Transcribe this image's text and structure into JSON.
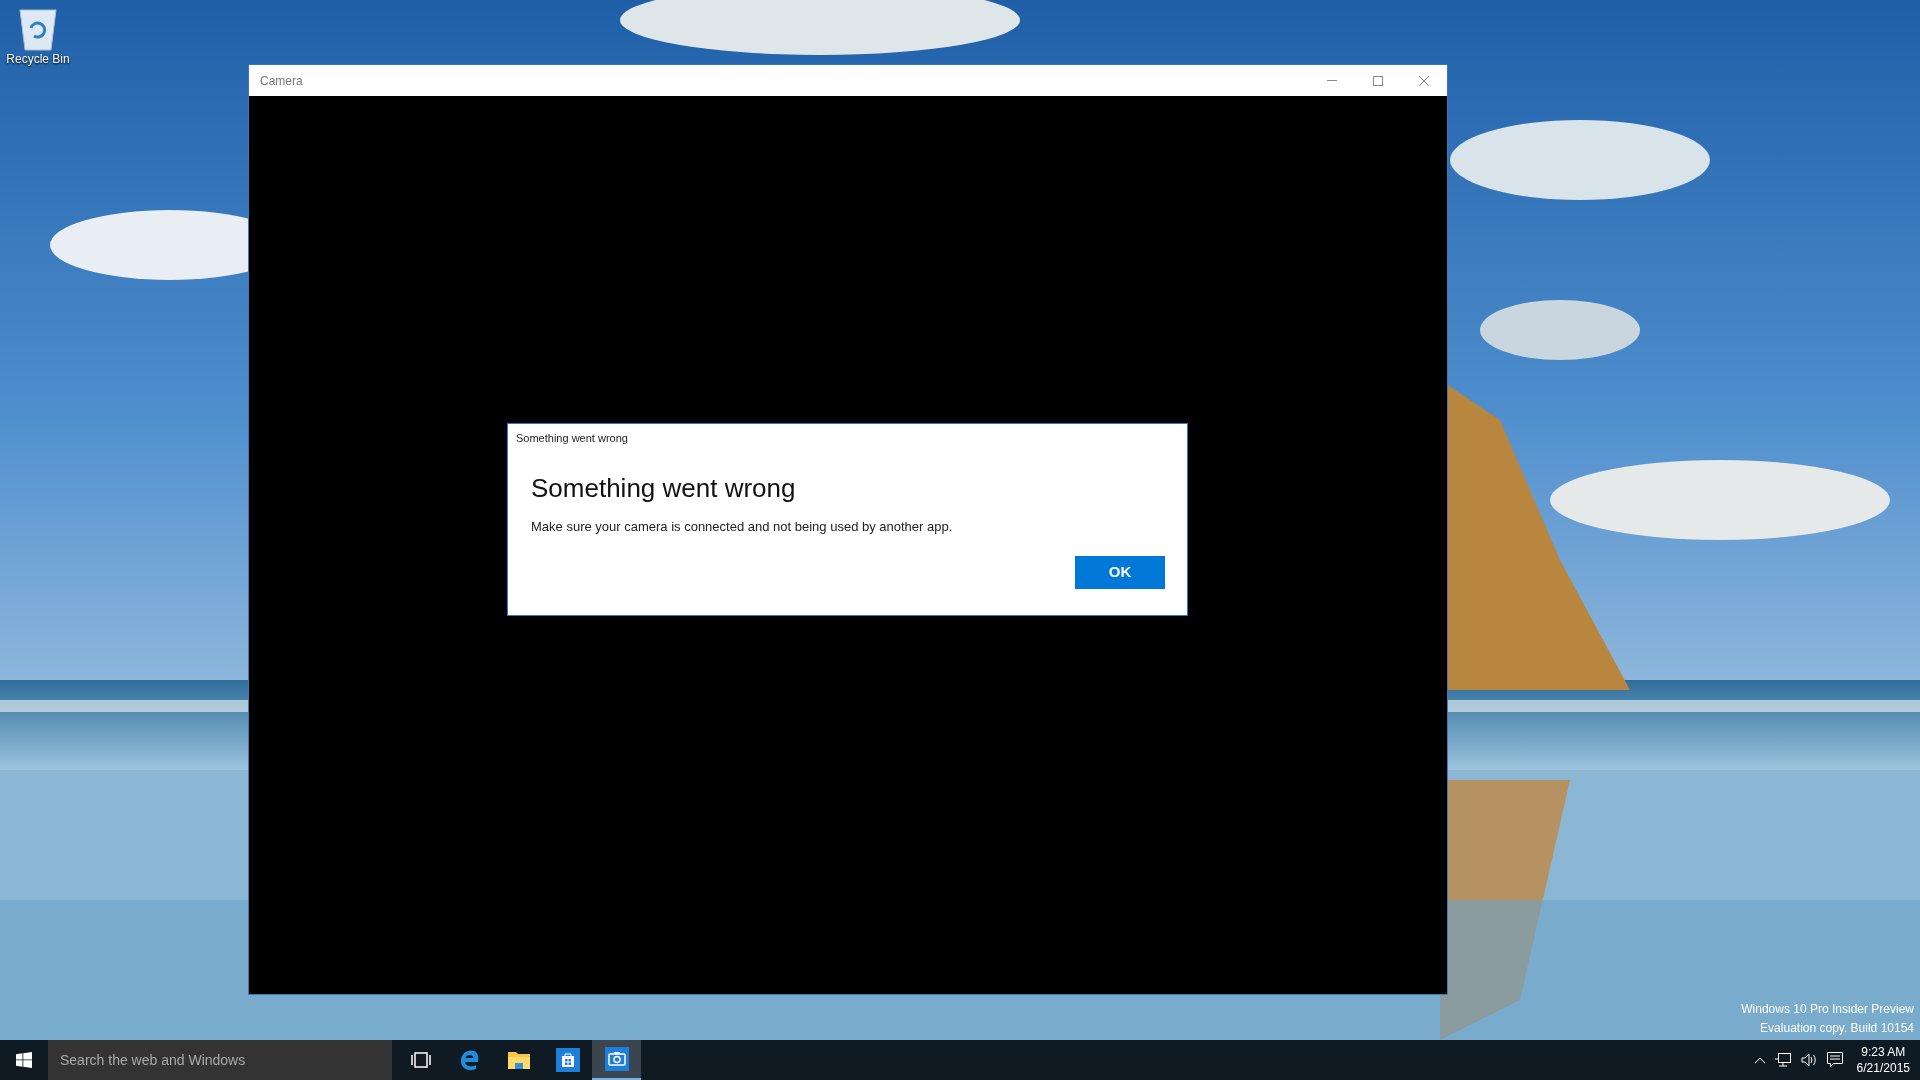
{
  "desktop_icons": [
    {
      "label": "Recycle Bin"
    }
  ],
  "window": {
    "title": "Camera",
    "dialog": {
      "caption": "Something went wrong",
      "heading": "Something went wrong",
      "message": "Make sure your camera is connected and not being used by another app.",
      "button": "OK"
    }
  },
  "watermark": [
    "Windows 10 Pro Insider Preview",
    "Evaluation copy. Build 10154"
  ],
  "taskbar": {
    "search": {
      "placeholder": "Search the web and Windows"
    },
    "apps": [
      {
        "kind": "taskview",
        "selected": false
      },
      {
        "kind": "browser",
        "selected": false
      },
      {
        "kind": "folder",
        "selected": false
      },
      {
        "kind": "store",
        "selected": false
      },
      {
        "kind": "camera",
        "selected": true
      }
    ],
    "clock": {
      "time": "9:23 AM",
      "date": "6/21/2015"
    }
  }
}
